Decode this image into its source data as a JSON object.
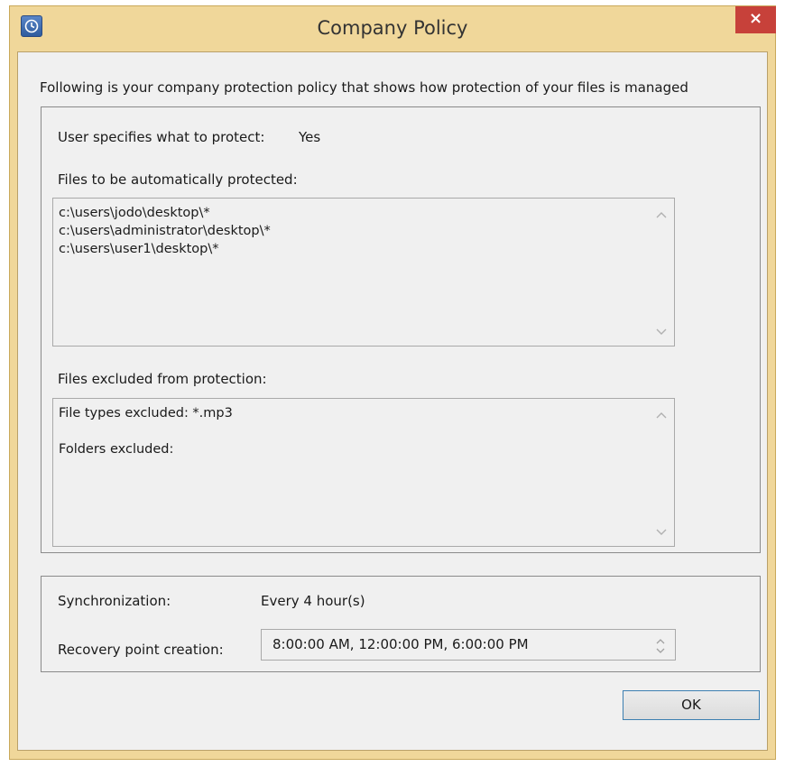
{
  "window": {
    "title": "Company Policy",
    "close_label": "×"
  },
  "intro_text": "Following is your company protection policy that shows how protection of your files is managed",
  "policy": {
    "user_specifies_label": "User specifies what to protect:",
    "user_specifies_value": "Yes",
    "auto_protected_label": "Files to be automatically protected:",
    "auto_protected_items": [
      "c:\\users\\jodo\\desktop\\*",
      "c:\\users\\administrator\\desktop\\*",
      "c:\\users\\user1\\desktop\\*"
    ],
    "excluded_label": "Files excluded from protection:",
    "excluded_file_types": "File types excluded: *.mp3",
    "excluded_folders": "Folders excluded:"
  },
  "sync": {
    "sync_label": "Synchronization:",
    "sync_value": "Every 4 hour(s)",
    "recovery_label": "Recovery point creation:",
    "recovery_value": "8:00:00 AM,  12:00:00 PM,  6:00:00 PM"
  },
  "buttons": {
    "ok_label": "OK"
  },
  "icons": {
    "app": "clock-restore-icon",
    "close": "close-icon",
    "scroll_up": "chevron-up-icon",
    "scroll_down": "chevron-down-icon",
    "spin": "spin-arrows-icon"
  },
  "colors": {
    "frame": "#f0d79a",
    "close_button": "#c7413a",
    "ok_border": "#3c7fb1",
    "client_bg": "#f0f0f0"
  }
}
